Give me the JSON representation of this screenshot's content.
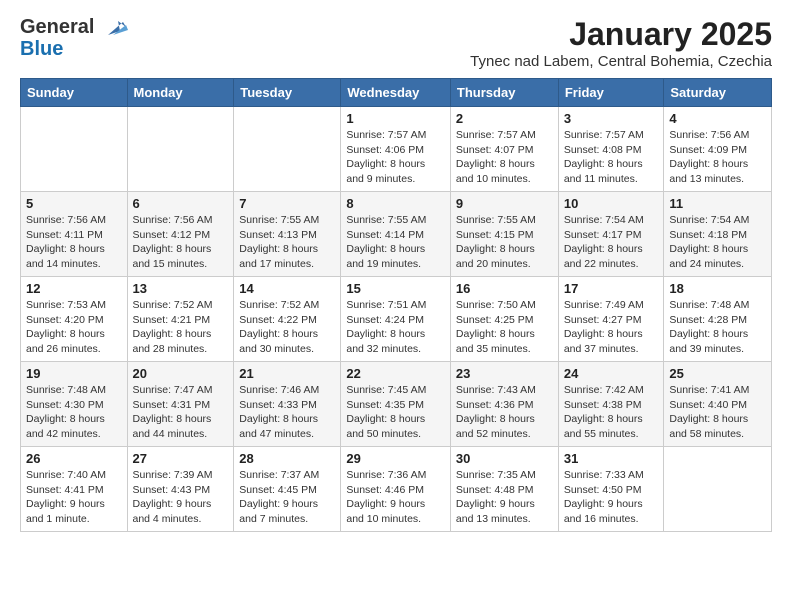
{
  "header": {
    "logo_general": "General",
    "logo_blue": "Blue",
    "month": "January 2025",
    "location": "Tynec nad Labem, Central Bohemia, Czechia"
  },
  "weekdays": [
    "Sunday",
    "Monday",
    "Tuesday",
    "Wednesday",
    "Thursday",
    "Friday",
    "Saturday"
  ],
  "weeks": [
    [
      {
        "day": "",
        "sunrise": "",
        "sunset": "",
        "daylight": ""
      },
      {
        "day": "",
        "sunrise": "",
        "sunset": "",
        "daylight": ""
      },
      {
        "day": "",
        "sunrise": "",
        "sunset": "",
        "daylight": ""
      },
      {
        "day": "1",
        "sunrise": "7:57 AM",
        "sunset": "4:06 PM",
        "daylight": "8 hours and 9 minutes."
      },
      {
        "day": "2",
        "sunrise": "7:57 AM",
        "sunset": "4:07 PM",
        "daylight": "8 hours and 10 minutes."
      },
      {
        "day": "3",
        "sunrise": "7:57 AM",
        "sunset": "4:08 PM",
        "daylight": "8 hours and 11 minutes."
      },
      {
        "day": "4",
        "sunrise": "7:56 AM",
        "sunset": "4:09 PM",
        "daylight": "8 hours and 13 minutes."
      }
    ],
    [
      {
        "day": "5",
        "sunrise": "7:56 AM",
        "sunset": "4:11 PM",
        "daylight": "8 hours and 14 minutes."
      },
      {
        "day": "6",
        "sunrise": "7:56 AM",
        "sunset": "4:12 PM",
        "daylight": "8 hours and 15 minutes."
      },
      {
        "day": "7",
        "sunrise": "7:55 AM",
        "sunset": "4:13 PM",
        "daylight": "8 hours and 17 minutes."
      },
      {
        "day": "8",
        "sunrise": "7:55 AM",
        "sunset": "4:14 PM",
        "daylight": "8 hours and 19 minutes."
      },
      {
        "day": "9",
        "sunrise": "7:55 AM",
        "sunset": "4:15 PM",
        "daylight": "8 hours and 20 minutes."
      },
      {
        "day": "10",
        "sunrise": "7:54 AM",
        "sunset": "4:17 PM",
        "daylight": "8 hours and 22 minutes."
      },
      {
        "day": "11",
        "sunrise": "7:54 AM",
        "sunset": "4:18 PM",
        "daylight": "8 hours and 24 minutes."
      }
    ],
    [
      {
        "day": "12",
        "sunrise": "7:53 AM",
        "sunset": "4:20 PM",
        "daylight": "8 hours and 26 minutes."
      },
      {
        "day": "13",
        "sunrise": "7:52 AM",
        "sunset": "4:21 PM",
        "daylight": "8 hours and 28 minutes."
      },
      {
        "day": "14",
        "sunrise": "7:52 AM",
        "sunset": "4:22 PM",
        "daylight": "8 hours and 30 minutes."
      },
      {
        "day": "15",
        "sunrise": "7:51 AM",
        "sunset": "4:24 PM",
        "daylight": "8 hours and 32 minutes."
      },
      {
        "day": "16",
        "sunrise": "7:50 AM",
        "sunset": "4:25 PM",
        "daylight": "8 hours and 35 minutes."
      },
      {
        "day": "17",
        "sunrise": "7:49 AM",
        "sunset": "4:27 PM",
        "daylight": "8 hours and 37 minutes."
      },
      {
        "day": "18",
        "sunrise": "7:48 AM",
        "sunset": "4:28 PM",
        "daylight": "8 hours and 39 minutes."
      }
    ],
    [
      {
        "day": "19",
        "sunrise": "7:48 AM",
        "sunset": "4:30 PM",
        "daylight": "8 hours and 42 minutes."
      },
      {
        "day": "20",
        "sunrise": "7:47 AM",
        "sunset": "4:31 PM",
        "daylight": "8 hours and 44 minutes."
      },
      {
        "day": "21",
        "sunrise": "7:46 AM",
        "sunset": "4:33 PM",
        "daylight": "8 hours and 47 minutes."
      },
      {
        "day": "22",
        "sunrise": "7:45 AM",
        "sunset": "4:35 PM",
        "daylight": "8 hours and 50 minutes."
      },
      {
        "day": "23",
        "sunrise": "7:43 AM",
        "sunset": "4:36 PM",
        "daylight": "8 hours and 52 minutes."
      },
      {
        "day": "24",
        "sunrise": "7:42 AM",
        "sunset": "4:38 PM",
        "daylight": "8 hours and 55 minutes."
      },
      {
        "day": "25",
        "sunrise": "7:41 AM",
        "sunset": "4:40 PM",
        "daylight": "8 hours and 58 minutes."
      }
    ],
    [
      {
        "day": "26",
        "sunrise": "7:40 AM",
        "sunset": "4:41 PM",
        "daylight": "9 hours and 1 minute."
      },
      {
        "day": "27",
        "sunrise": "7:39 AM",
        "sunset": "4:43 PM",
        "daylight": "9 hours and 4 minutes."
      },
      {
        "day": "28",
        "sunrise": "7:37 AM",
        "sunset": "4:45 PM",
        "daylight": "9 hours and 7 minutes."
      },
      {
        "day": "29",
        "sunrise": "7:36 AM",
        "sunset": "4:46 PM",
        "daylight": "9 hours and 10 minutes."
      },
      {
        "day": "30",
        "sunrise": "7:35 AM",
        "sunset": "4:48 PM",
        "daylight": "9 hours and 13 minutes."
      },
      {
        "day": "31",
        "sunrise": "7:33 AM",
        "sunset": "4:50 PM",
        "daylight": "9 hours and 16 minutes."
      },
      {
        "day": "",
        "sunrise": "",
        "sunset": "",
        "daylight": ""
      }
    ]
  ]
}
